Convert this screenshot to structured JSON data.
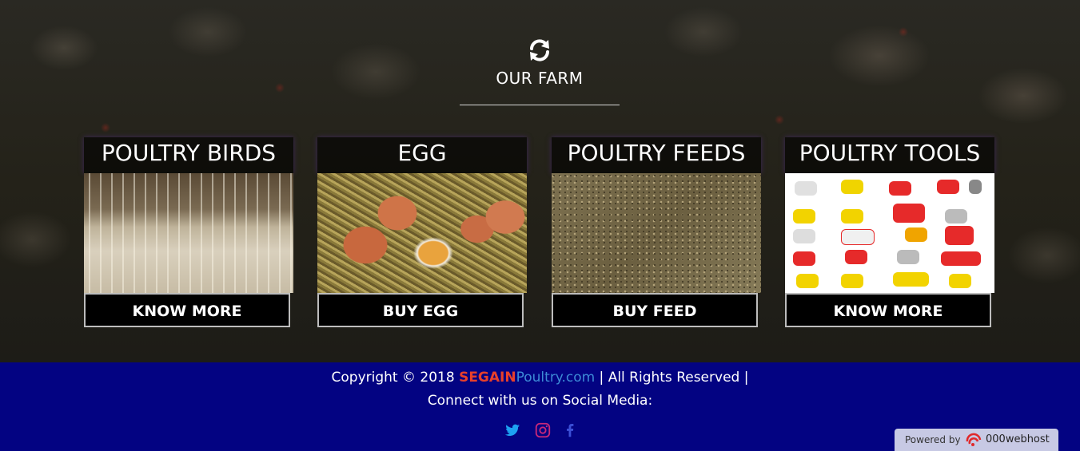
{
  "section": {
    "icon": "refresh-icon",
    "title": "OUR FARM"
  },
  "cards": [
    {
      "title": "POULTRY BIRDS",
      "image": "poultry-house-photo",
      "button": "KNOW MORE"
    },
    {
      "title": "EGG",
      "image": "brown-eggs-photo",
      "button": "BUY EGG"
    },
    {
      "title": "POULTRY FEEDS",
      "image": "feed-pellets-photo",
      "button": "BUY FEED"
    },
    {
      "title": "POULTRY TOOLS",
      "image": "poultry-tools-photo",
      "button": "KNOW MORE"
    }
  ],
  "footer": {
    "copyright_prefix": "Copyright © 2018 ",
    "brand_red": "SEGAIN",
    "brand_blue": "Poultry.com",
    "copyright_suffix": " | All Rights Reserved |",
    "social_text": "Connect with us on Social Media:",
    "social_icons": [
      "twitter-icon",
      "instagram-icon",
      "facebook-icon"
    ],
    "colors": {
      "background": "#030382",
      "brand_red": "#e8402a",
      "brand_blue": "#3d8bd6"
    }
  },
  "badge": {
    "powered_by": "Powered by",
    "host": "000webhost"
  }
}
